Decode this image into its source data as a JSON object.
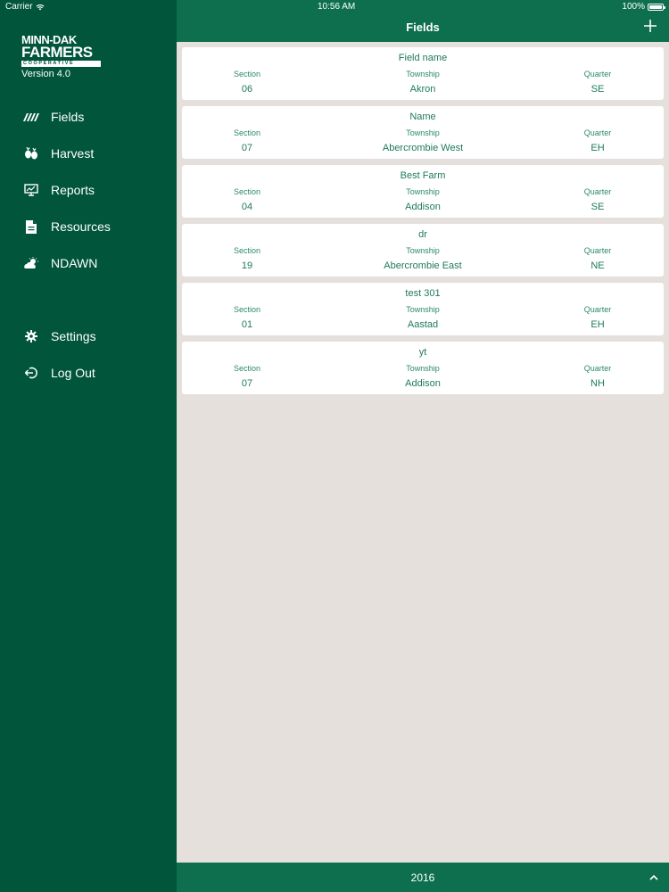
{
  "status": {
    "carrier": "Carrier",
    "time": "10:56 AM",
    "battery": "100%"
  },
  "brand": {
    "line1": "MINN-DAK",
    "line2": "FARMERS",
    "line3": "COOPERATIVE",
    "version": "Version 4.0"
  },
  "nav": {
    "items": [
      {
        "label": "Fields",
        "icon": "fields-icon"
      },
      {
        "label": "Harvest",
        "icon": "harvest-icon"
      },
      {
        "label": "Reports",
        "icon": "reports-icon"
      },
      {
        "label": "Resources",
        "icon": "document-icon"
      },
      {
        "label": "NDAWN",
        "icon": "weather-icon"
      },
      {
        "label": "Settings",
        "icon": "gear-icon"
      },
      {
        "label": "Log Out",
        "icon": "logout-icon"
      }
    ]
  },
  "header": {
    "title": "Fields",
    "add_icon": "plus-icon"
  },
  "columns": {
    "section": "Section",
    "township": "Township",
    "quarter": "Quarter"
  },
  "fields": [
    {
      "name": "Field name",
      "section": "06",
      "township": "Akron",
      "quarter": "SE"
    },
    {
      "name": "Name",
      "section": "07",
      "township": "Abercrombie West",
      "quarter": "EH"
    },
    {
      "name": "Best Farm",
      "section": "04",
      "township": "Addison",
      "quarter": "SE"
    },
    {
      "name": "dr",
      "section": "19",
      "township": "Abercrombie East",
      "quarter": "NE"
    },
    {
      "name": "test 301",
      "section": "01",
      "township": "Aastad",
      "quarter": "EH"
    },
    {
      "name": "yt",
      "section": "07",
      "township": "Addison",
      "quarter": "NH"
    }
  ],
  "footer": {
    "year": "2016",
    "toggle_icon": "chevron-up-icon"
  },
  "colors": {
    "sidebar": "#00553b",
    "bar": "#0e6f4f",
    "text": "#1f7a5a",
    "background": "#e6e0dc"
  }
}
